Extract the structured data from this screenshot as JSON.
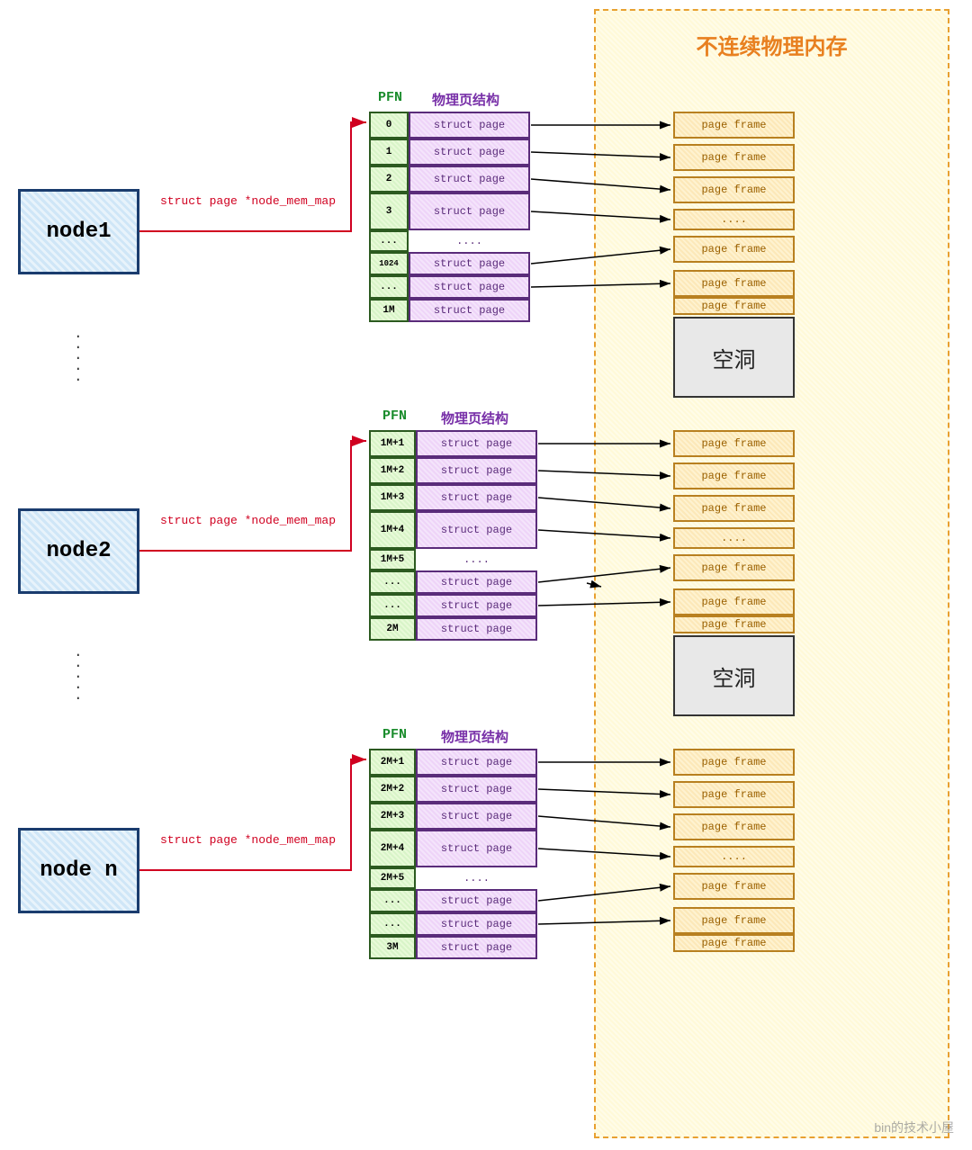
{
  "memory_title": "不连续物理内存",
  "nodes": [
    {
      "label": "node1"
    },
    {
      "label": "node2"
    },
    {
      "label": "node n"
    }
  ],
  "pointer_label": "struct page *node_mem_map",
  "headers": {
    "pfn": "PFN",
    "struct": "物理页结构"
  },
  "struct_text": "struct page",
  "struct_ellipsis": "....",
  "frame_text": "page frame",
  "frame_ellipsis": "....",
  "hole_text": "空洞",
  "tables": [
    {
      "pfns": [
        "0",
        "1",
        "2",
        "3",
        "...",
        "1024",
        "...",
        "1M"
      ]
    },
    {
      "pfns": [
        "1M+1",
        "1M+2",
        "1M+3",
        "1M+4",
        "1M+5",
        "...",
        "...",
        "2M"
      ]
    },
    {
      "pfns": [
        "2M+1",
        "2M+2",
        "2M+3",
        "2M+4",
        "2M+5",
        "...",
        "...",
        "3M"
      ]
    }
  ],
  "watermark": "bin的技术小屋"
}
